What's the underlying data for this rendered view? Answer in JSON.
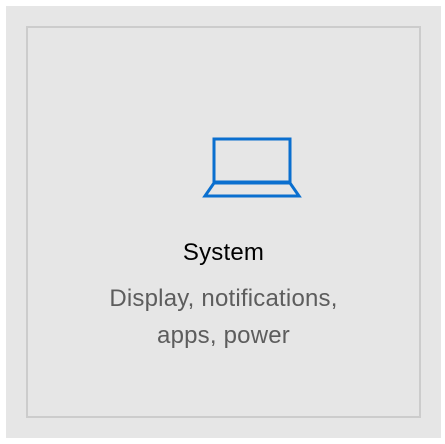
{
  "tile": {
    "icon": "laptop-icon",
    "title": "System",
    "description_line1": "Display, notifications,",
    "description_line2": "apps, power"
  },
  "colors": {
    "tile_background": "#e6e6e6",
    "tile_border": "#cccccc",
    "accent": "#0a6fcf",
    "title_text": "#000000",
    "description_text": "#5d5d5d"
  }
}
